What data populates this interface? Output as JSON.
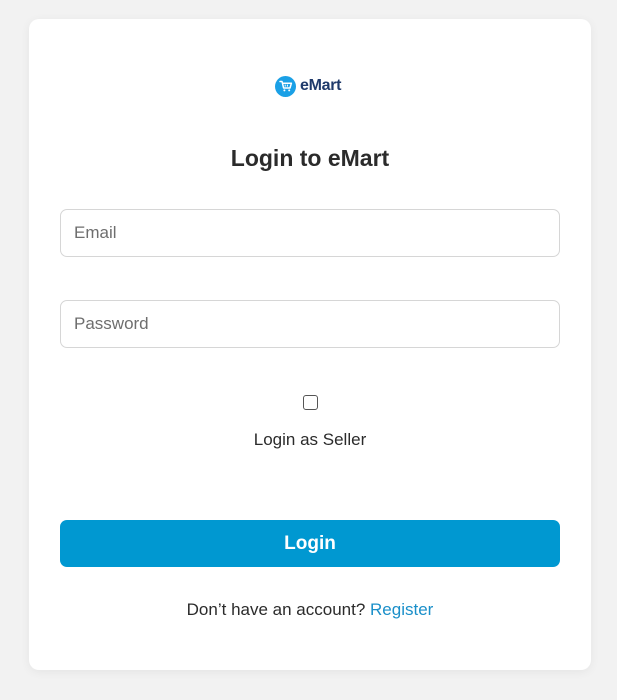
{
  "brand": {
    "name": "eMart",
    "icon": "shopping-cart-icon",
    "badge_color": "#1aa0e6",
    "name_color": "#1f3a6b"
  },
  "form": {
    "title": "Login to eMart",
    "email": {
      "value": "",
      "placeholder": "Email"
    },
    "password": {
      "value": "",
      "placeholder": "Password"
    },
    "seller_checkbox": {
      "checked": false,
      "label": "Login as Seller"
    },
    "submit_label": "Login",
    "submit_color": "#0098d1"
  },
  "footer": {
    "prompt": "Don’t have an account?",
    "link_label": "Register",
    "link_color": "#1a8fc9"
  }
}
